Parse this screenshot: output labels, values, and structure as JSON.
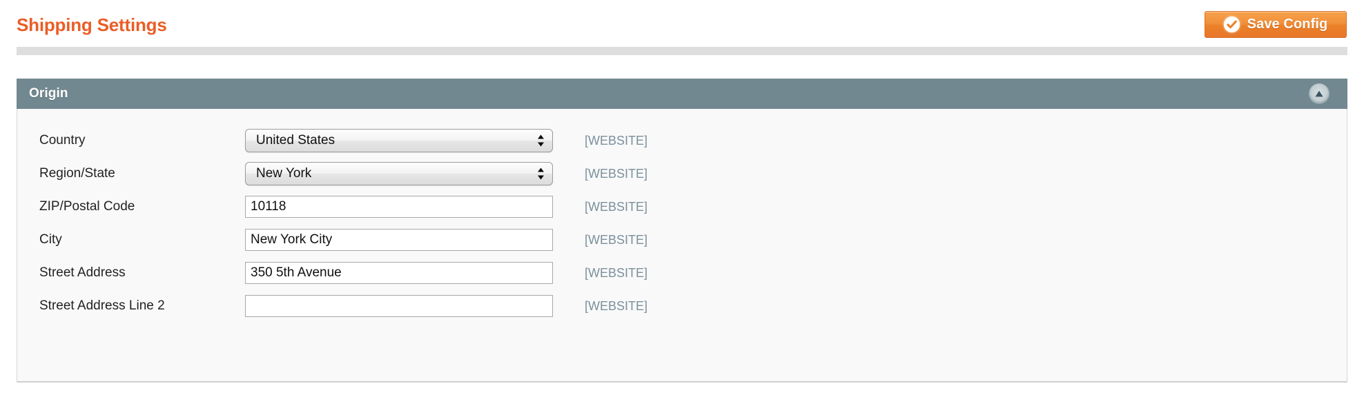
{
  "page": {
    "title": "Shipping Settings"
  },
  "toolbar": {
    "save_label": "Save Config",
    "save_icon": "check-circle-icon"
  },
  "colors": {
    "accent_orange": "#eb5d26",
    "button_orange": "#ec8128",
    "panel_header": "#718890",
    "scope_label": "#7b909b",
    "divider": "#dedede",
    "panel_body": "#f9f9f9"
  },
  "panel": {
    "title": "Origin",
    "collapse_icon": "triangle-up-icon",
    "rows": [
      {
        "label": "Country",
        "type": "select",
        "value": "United States",
        "scope": "[WEBSITE]"
      },
      {
        "label": "Region/State",
        "type": "select",
        "value": "New York",
        "scope": "[WEBSITE]"
      },
      {
        "label": "ZIP/Postal Code",
        "type": "text",
        "value": "10118",
        "placeholder": "",
        "scope": "[WEBSITE]"
      },
      {
        "label": "City",
        "type": "text",
        "value": "New York City",
        "placeholder": "",
        "scope": "[WEBSITE]"
      },
      {
        "label": "Street Address",
        "type": "text",
        "value": "350 5th Avenue",
        "placeholder": "",
        "scope": "[WEBSITE]"
      },
      {
        "label": "Street Address Line 2",
        "type": "text",
        "value": "",
        "placeholder": "",
        "scope": "[WEBSITE]"
      }
    ]
  }
}
